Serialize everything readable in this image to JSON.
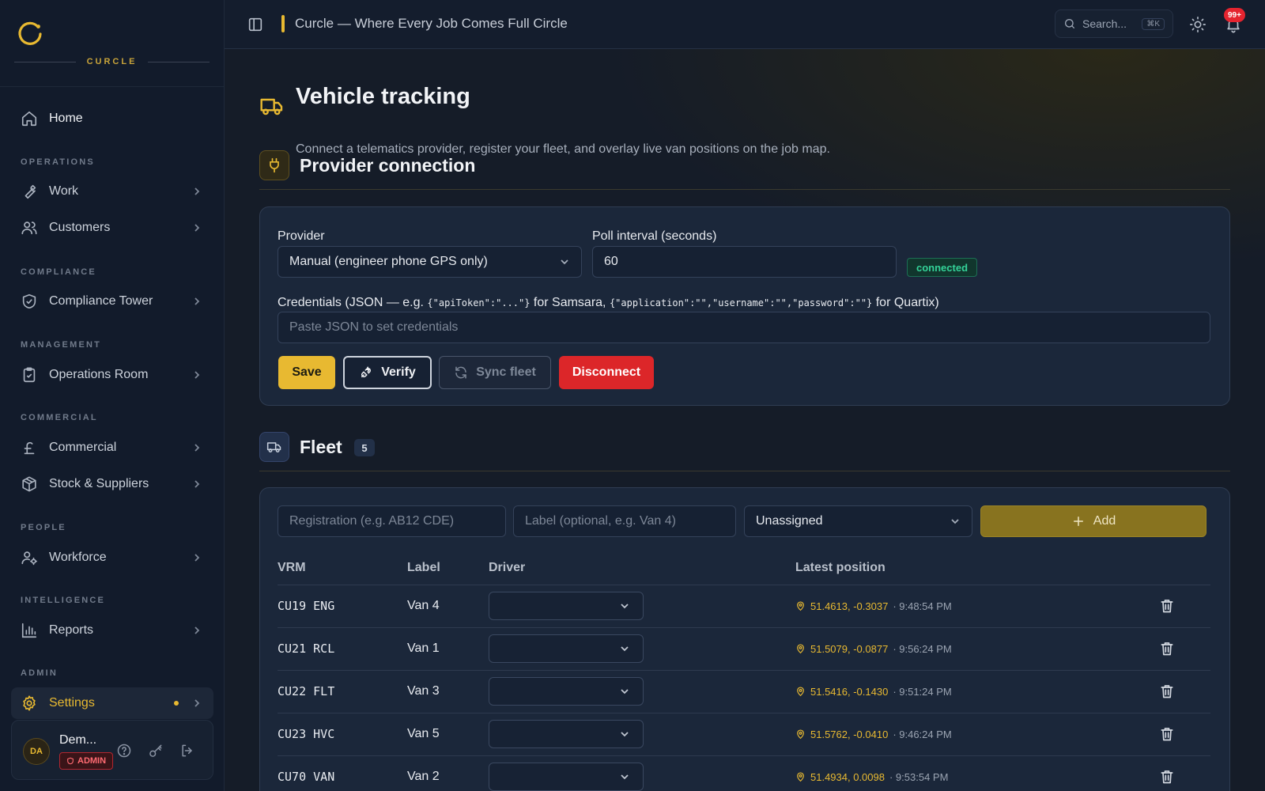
{
  "app": {
    "brand": "CURCLE",
    "title": "Curcle — Where Every Job Comes Full Circle"
  },
  "topbar": {
    "search_placeholder": "Search...",
    "search_shortcut": "⌘K",
    "notifications_badge": "99+"
  },
  "sidebar": {
    "home": "Home",
    "sections": {
      "operations": "OPERATIONS",
      "compliance": "COMPLIANCE",
      "management": "MANAGEMENT",
      "commercial": "COMMERCIAL",
      "people": "PEOPLE",
      "intelligence": "INTELLIGENCE",
      "admin": "ADMIN"
    },
    "items": {
      "work": "Work",
      "customers": "Customers",
      "compliance_tower": "Compliance Tower",
      "operations_room": "Operations Room",
      "commercial": "Commercial",
      "stock": "Stock & Suppliers",
      "workforce": "Workforce",
      "reports": "Reports",
      "settings": "Settings"
    },
    "user": {
      "initials": "DA",
      "name": "Dem...",
      "role": "ADMIN"
    }
  },
  "page": {
    "title": "Vehicle tracking",
    "subtitle": "Connect a telematics provider, register your fleet, and overlay live van positions on the job map."
  },
  "provider": {
    "heading": "Provider connection",
    "provider_label": "Provider",
    "provider_value": "Manual (engineer phone GPS only)",
    "poll_label": "Poll interval (seconds)",
    "poll_value": "60",
    "status": "connected",
    "cred_label_a": "Credentials (JSON — e.g. ",
    "cred_code_a": "{\"apiToken\":\"...\"}",
    "cred_label_b": " for Samsara, ",
    "cred_code_b": "{\"application\":\"\",\"username\":\"\",\"password\":\"\"}",
    "cred_label_c": " for Quartix)",
    "cred_placeholder": "Paste JSON to set credentials",
    "buttons": {
      "save": "Save",
      "verify": "Verify",
      "sync": "Sync fleet",
      "disconnect": "Disconnect"
    }
  },
  "fleet": {
    "heading": "Fleet",
    "count": "5",
    "reg_placeholder": "Registration (e.g. AB12 CDE)",
    "label_placeholder": "Label (optional, e.g. Van 4)",
    "driver_select": "Unassigned",
    "add_label": "Add",
    "columns": {
      "vrm": "VRM",
      "label": "Label",
      "driver": "Driver",
      "position": "Latest position"
    },
    "rows": [
      {
        "vrm": "CU19 ENG",
        "label": "Van 4",
        "coords": "51.4613, -0.3037",
        "time": "· 9:48:54 PM"
      },
      {
        "vrm": "CU21 RCL",
        "label": "Van 1",
        "coords": "51.5079, -0.0877",
        "time": "· 9:56:24 PM"
      },
      {
        "vrm": "CU22 FLT",
        "label": "Van 3",
        "coords": "51.5416, -0.1430",
        "time": "· 9:51:24 PM"
      },
      {
        "vrm": "CU23 HVC",
        "label": "Van 5",
        "coords": "51.5762, -0.0410",
        "time": "· 9:46:24 PM"
      },
      {
        "vrm": "CU70 VAN",
        "label": "Van 2",
        "coords": "51.4934, 0.0098",
        "time": "· 9:53:54 PM"
      }
    ]
  },
  "colors": {
    "accent": "#e8b931",
    "danger": "#dc2626",
    "success": "#34d399",
    "background": "#151c28"
  }
}
